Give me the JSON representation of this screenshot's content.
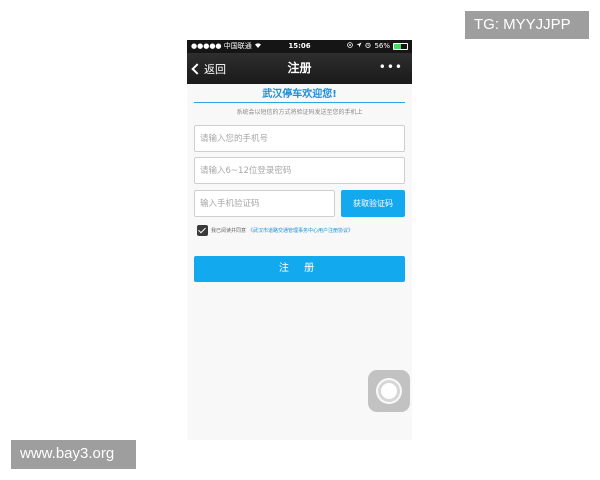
{
  "watermarks": {
    "top_right": "TG: MYYJJPP",
    "bottom_left": "www.bay3.org"
  },
  "status_bar": {
    "signal": "●●●●●",
    "carrier": "中国联通",
    "wifi_icon": "wifi-icon",
    "time": "15:06",
    "right_icons": [
      "lock-rotation-icon",
      "location-icon",
      "alarm-icon"
    ],
    "battery_percent": "56%",
    "battery_level": 0.56
  },
  "nav_bar": {
    "back_label": "返回",
    "title": "注册",
    "more_label": "•••"
  },
  "form": {
    "heading": "武汉停车欢迎您!",
    "subtitle": "系统会以短信的方式将验证码发送至您的手机上",
    "phone_placeholder": "请输入您的手机号",
    "password_placeholder": "请输入6~12位登录密码",
    "code_placeholder": "输入手机验证码",
    "get_code_button": "获取验证码",
    "agree_text": "我已阅读并同意",
    "agree_link": "《武汉市道路交通管理事务中心用户注册协议》",
    "agree_checked": true,
    "submit_button": "注 册"
  },
  "colors": {
    "accent": "#13a9ef",
    "heading": "#1e8fd8",
    "navbar": "#1f1f1f",
    "page_background": "#f8f8f8"
  }
}
